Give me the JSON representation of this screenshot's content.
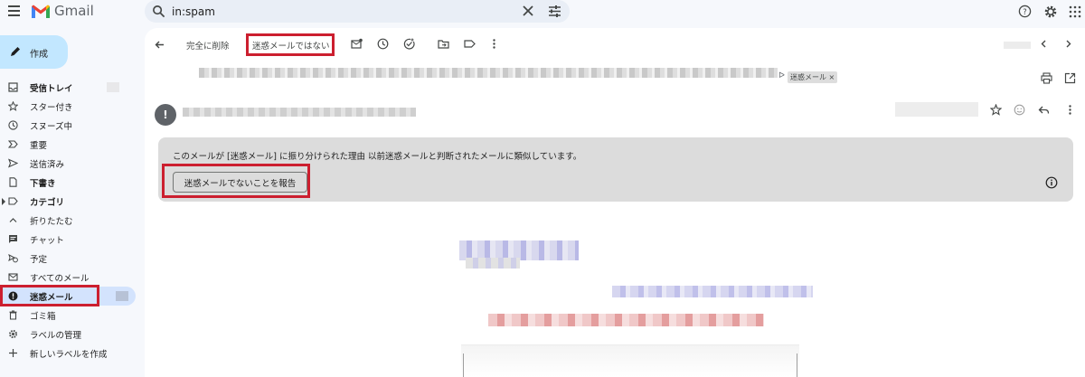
{
  "app": {
    "brand": "Gmail"
  },
  "search": {
    "value": "in:spam"
  },
  "compose": {
    "label": "作成"
  },
  "sidebar": {
    "items": [
      {
        "label": "受信トレイ",
        "icon": "inbox-icon"
      },
      {
        "label": "スター付き",
        "icon": "star-icon"
      },
      {
        "label": "スヌーズ中",
        "icon": "clock-icon"
      },
      {
        "label": "重要",
        "icon": "important-icon"
      },
      {
        "label": "送信済み",
        "icon": "send-icon"
      },
      {
        "label": "下書き",
        "icon": "draft-icon"
      },
      {
        "label": "カテゴリ",
        "icon": "label-icon"
      },
      {
        "label": "折りたたむ",
        "icon": "chevron-up-icon"
      },
      {
        "label": "チャット",
        "icon": "chat-icon"
      },
      {
        "label": "予定",
        "icon": "scheduled-icon"
      },
      {
        "label": "すべてのメール",
        "icon": "all-mail-icon"
      },
      {
        "label": "迷惑メール",
        "icon": "spam-icon"
      },
      {
        "label": "ゴミ箱",
        "icon": "trash-icon"
      },
      {
        "label": "ラベルの管理",
        "icon": "gear-icon"
      },
      {
        "label": "新しいラベルを作成",
        "icon": "plus-icon"
      }
    ]
  },
  "toolbar": {
    "delete_forever": "完全に削除",
    "not_spam": "迷惑メールではない"
  },
  "message": {
    "label_chip": "迷惑メール ×",
    "avatar_glyph": "!"
  },
  "banner": {
    "text": "このメールが [迷惑メール] に振り分けられた理由 以前迷惑メールと判断されたメールに類似しています。",
    "button": "迷惑メールでないことを報告"
  },
  "colors": {
    "highlight": "#cc1f2f",
    "active_nav": "#d3e3fd",
    "compose": "#c2e7ff"
  }
}
